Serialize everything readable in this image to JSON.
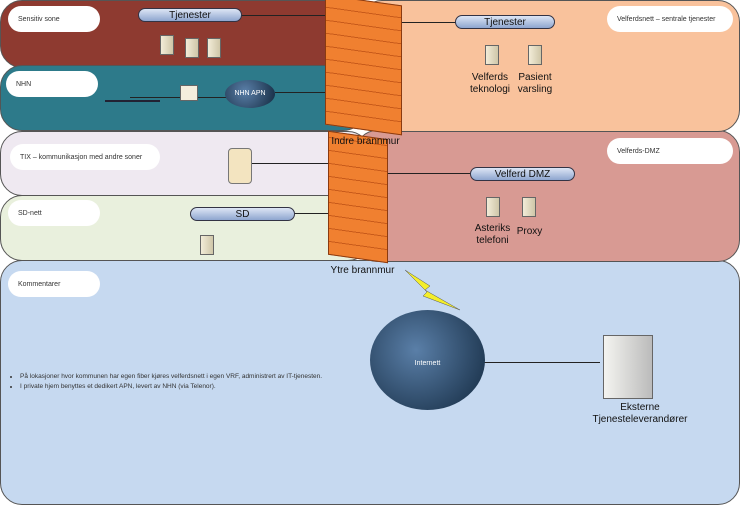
{
  "zones": {
    "sensitiv": "Sensitiv sone",
    "nhn": "NHN",
    "velferdsnett": "Velferdsnett – sentrale tjenester",
    "tix": "TIX – kommunikasjon med andre soner",
    "sd": "SD-nett",
    "dmz": "Velferds-DMZ",
    "kommentarer": "Kommentarer"
  },
  "buses": {
    "tjenester_left": "Tjenester",
    "tjenester_right": "Tjenester",
    "velferd_dmz": "Velferd DMZ",
    "sd": "SD"
  },
  "labels": {
    "velferdsteknologi": "Velferds teknologi",
    "pasientvarsling": "Pasient varsling",
    "asteriks": "Asteriks telefoni",
    "proxy": "Proxy",
    "nhn_apn": "NHN APN",
    "indre": "Indre brannmur",
    "ytre": "Ytre brannmur",
    "internett": "Internett",
    "eksterne": "Eksterne Tjenesteleverandører"
  },
  "comments": [
    "På lokasjoner hvor kommunen har egen fiber kjøres velferdsnett i egen VRF, administrert av IT-tjenesten.",
    "I private hjem benyttes et dedikert APN, levert av NHN (via Telenor)."
  ],
  "colors": {
    "sensitiv": "#8e3a30",
    "nhn": "#2d7a8a",
    "velferdsnett": "#f9c29c",
    "tix": "#efe9f1",
    "sd": "#e9f0dd",
    "dmz": "#d89a93",
    "kommentarer": "#c6d9f0",
    "firewall": "#f08030"
  }
}
